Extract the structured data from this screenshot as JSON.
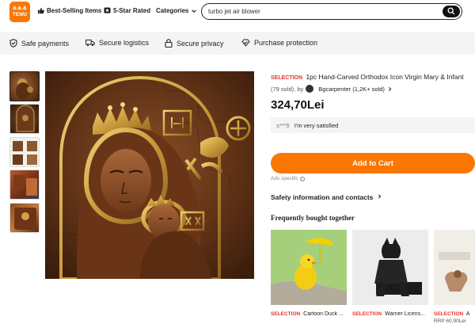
{
  "header": {
    "logo_top": "≗≗≗",
    "logo_text": "TEMU",
    "nav_best_selling": "Best-Selling Items",
    "nav_star_rated": "5-Star Rated",
    "nav_categories": "Categories",
    "search_value": "turbo jet air blower"
  },
  "trust": {
    "payments": "Safe payments",
    "logistics": "Secure logistics",
    "privacy": "Secure privacy",
    "protection": "Purchase protection"
  },
  "product": {
    "badge": "SELECTION",
    "title": "1pc Hand-Carved Orthodox Icon Virgin Mary & Infant",
    "sold": "(79 sold), by",
    "seller": "Bgcarpenter (1,2K+ sold)",
    "price": "324,70Lei",
    "review_user": "s***5",
    "review_text": "I'm very satisfied",
    "add_to_cart": "Add to Cart",
    "ads_specific": "Ads specific",
    "safety": "Safety information and contacts",
    "fbt_heading": "Frequently bought together"
  },
  "related": [
    {
      "badge": "SELECTION",
      "name": "Cartoon Duck ..."
    },
    {
      "badge": "SELECTION",
      "name": "Warner Licens..."
    },
    {
      "badge": "SELECTION",
      "name": "A",
      "rrp": "RRP 60,90Lei"
    }
  ],
  "colors": {
    "accent": "#fb7701",
    "selection_red": "#e8302b"
  }
}
